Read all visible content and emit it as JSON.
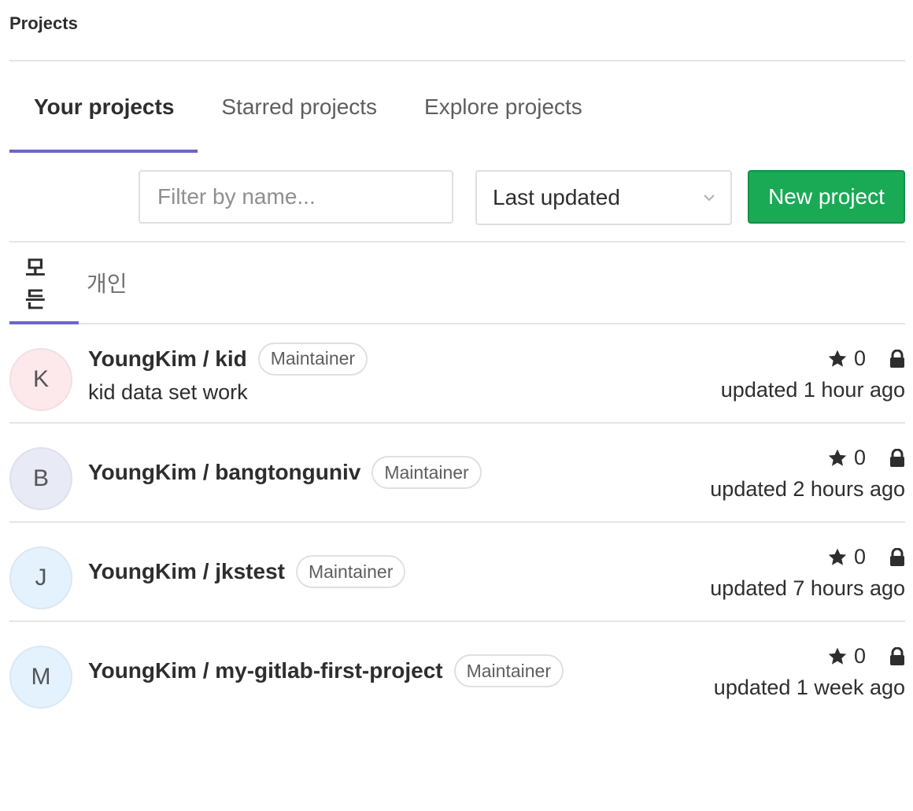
{
  "breadcrumb": {
    "title": "Projects"
  },
  "tabs": [
    {
      "label": "Your projects",
      "active": true
    },
    {
      "label": "Starred projects",
      "active": false
    },
    {
      "label": "Explore projects",
      "active": false
    }
  ],
  "controls": {
    "filter_placeholder": "Filter by name...",
    "sort_value": "Last updated",
    "new_project_label": "New project",
    "new_project_color": "#1aaa55"
  },
  "sub_tabs": [
    {
      "label": "모든",
      "active": true
    },
    {
      "label": "개인",
      "active": false
    }
  ],
  "accent_color": "#6b67c8",
  "projects": [
    {
      "avatar_letter": "K",
      "avatar_color": "#fde9ec",
      "name": "YoungKim / kid",
      "role": "Maintainer",
      "description": "kid data set work",
      "stars": "0",
      "visibility_icon": "lock-icon",
      "updated": "updated 1 hour ago"
    },
    {
      "avatar_letter": "B",
      "avatar_color": "#e8eaf6",
      "name": "YoungKim / bangtonguniv",
      "role": "Maintainer",
      "description": "",
      "stars": "0",
      "visibility_icon": "lock-icon",
      "updated": "updated 2 hours ago"
    },
    {
      "avatar_letter": "J",
      "avatar_color": "#e3f2fd",
      "name": "YoungKim / jkstest",
      "role": "Maintainer",
      "description": "",
      "stars": "0",
      "visibility_icon": "lock-icon",
      "updated": "updated 7 hours ago"
    },
    {
      "avatar_letter": "M",
      "avatar_color": "#e3f2fd",
      "name": "YoungKim / my-gitlab-first-project",
      "role": "Maintainer",
      "description": "",
      "stars": "0",
      "visibility_icon": "lock-icon",
      "updated": "updated 1 week ago"
    }
  ]
}
